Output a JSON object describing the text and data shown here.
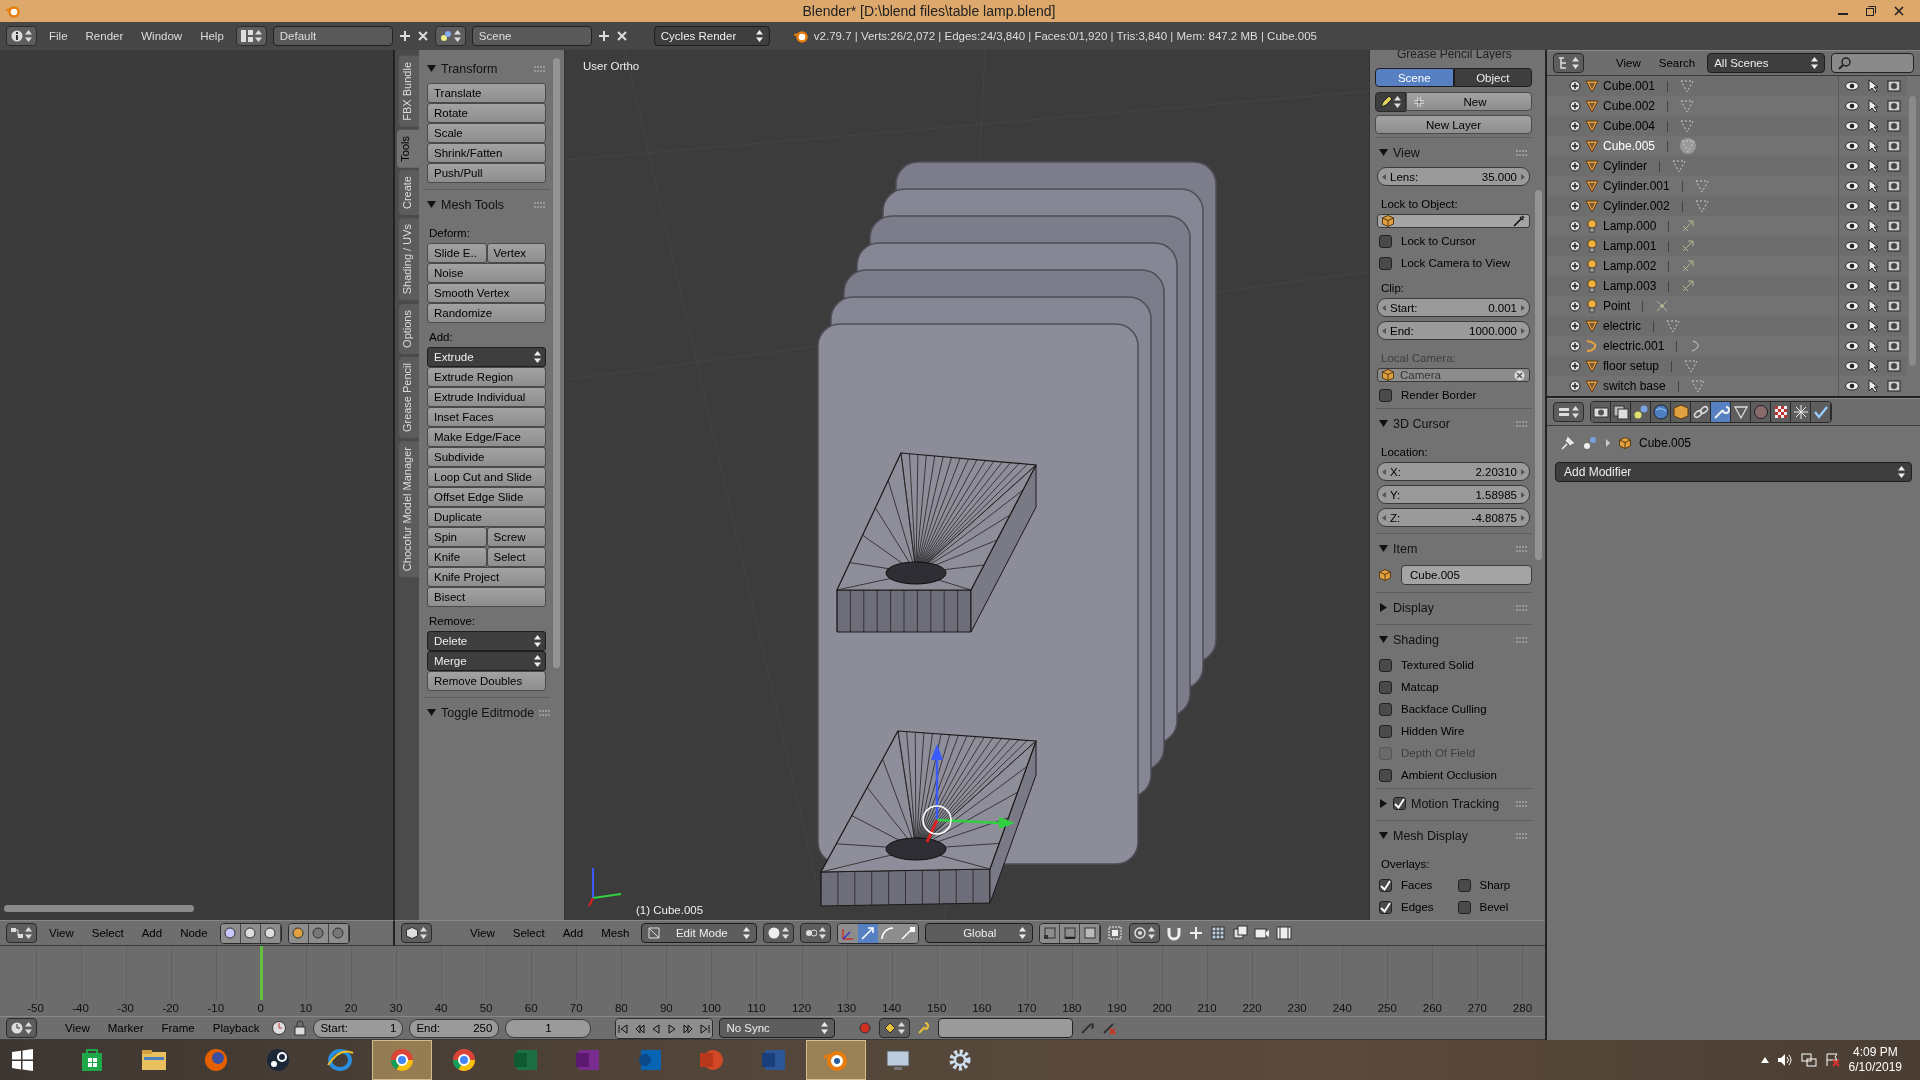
{
  "window": {
    "title": "Blender* [D:\\blend files\\table lamp.blend]"
  },
  "info_header": {
    "menus": [
      "File",
      "Render",
      "Window",
      "Help"
    ],
    "layout": "Default",
    "scene": "Scene",
    "engine": "Cycles Render",
    "stats": "v2.79.7 | Verts:26/2,072 | Edges:24/3,840 | Faces:0/1,920 | Tris:3,840 | Mem: 847.2 MB | Cube.005"
  },
  "tool_shelf": {
    "tabs": [
      {
        "label": "FBX Bundle",
        "selected": false
      },
      {
        "label": "Tools",
        "selected": true
      },
      {
        "label": "Create",
        "selected": false
      },
      {
        "label": "Shading / UVs",
        "selected": false
      },
      {
        "label": "Options",
        "selected": false
      },
      {
        "label": "Grease Pencil",
        "selected": false
      },
      {
        "label": "Chocofur Model Manager",
        "selected": false
      }
    ],
    "panels": [
      {
        "title": "Transform",
        "expanded": true,
        "rows": [
          {
            "kind": "button",
            "labels": [
              "Translate"
            ]
          },
          {
            "kind": "button",
            "labels": [
              "Rotate"
            ]
          },
          {
            "kind": "button",
            "labels": [
              "Scale"
            ]
          },
          {
            "kind": "button",
            "labels": [
              "Shrink/Fatten"
            ]
          },
          {
            "kind": "button",
            "labels": [
              "Push/Pull"
            ]
          }
        ]
      },
      {
        "title": "Mesh Tools",
        "expanded": true,
        "rows": [
          {
            "kind": "label",
            "text": "Deform:"
          },
          {
            "kind": "button",
            "labels": [
              "Slide E..",
              "Vertex"
            ]
          },
          {
            "kind": "button",
            "labels": [
              "Noise"
            ]
          },
          {
            "kind": "button",
            "labels": [
              "Smooth Vertex"
            ]
          },
          {
            "kind": "button",
            "labels": [
              "Randomize"
            ]
          },
          {
            "kind": "label",
            "text": "Add:"
          },
          {
            "kind": "dropdown",
            "text": "Extrude"
          },
          {
            "kind": "button",
            "labels": [
              "Extrude Region"
            ]
          },
          {
            "kind": "button",
            "labels": [
              "Extrude Individual"
            ]
          },
          {
            "kind": "button",
            "labels": [
              "Inset Faces"
            ]
          },
          {
            "kind": "button",
            "labels": [
              "Make Edge/Face"
            ]
          },
          {
            "kind": "button",
            "labels": [
              "Subdivide"
            ]
          },
          {
            "kind": "button",
            "labels": [
              "Loop Cut and Slide"
            ]
          },
          {
            "kind": "button",
            "labels": [
              "Offset Edge Slide"
            ]
          },
          {
            "kind": "button",
            "labels": [
              "Duplicate"
            ]
          },
          {
            "kind": "button",
            "labels": [
              "Spin",
              "Screw"
            ]
          },
          {
            "kind": "button",
            "labels": [
              "Knife",
              "Select"
            ]
          },
          {
            "kind": "button",
            "labels": [
              "Knife Project"
            ]
          },
          {
            "kind": "button",
            "labels": [
              "Bisect"
            ]
          },
          {
            "kind": "label",
            "text": "Remove:"
          },
          {
            "kind": "dropdown",
            "text": "Delete"
          },
          {
            "kind": "dropdown",
            "text": "Merge"
          },
          {
            "kind": "button",
            "labels": [
              "Remove Doubles"
            ]
          }
        ]
      },
      {
        "title": "Toggle Editmode",
        "expanded": true
      }
    ]
  },
  "viewport": {
    "view_name": "User Ortho",
    "object_label": "(1) Cube.005"
  },
  "n_panel": {
    "cut_header": "Grease Pencil Layers",
    "modes": [
      {
        "label": "Scene",
        "selected": true
      },
      {
        "label": "Object",
        "selected": false
      }
    ],
    "new_button": "New",
    "new_layer_button": "New Layer",
    "panels": [
      {
        "title": "View",
        "expanded": true,
        "rows": [
          {
            "kind": "number",
            "label": "Lens:",
            "value": "35.000"
          },
          {
            "kind": "label",
            "text": "Lock to Object:",
            "disabled": false
          },
          {
            "kind": "object_field",
            "disabled": false
          },
          {
            "kind": "checkbox",
            "text": "Lock to Cursor",
            "checked": false,
            "disabled": false
          },
          {
            "kind": "checkbox",
            "text": "Lock Camera to View",
            "checked": false,
            "disabled": false
          },
          {
            "kind": "label",
            "text": "Clip:",
            "disabled": false
          },
          {
            "kind": "number",
            "label": "Start:",
            "value": "0.001"
          },
          {
            "kind": "number",
            "label": "End:",
            "value": "1000.000"
          },
          {
            "kind": "label",
            "text": "Local Camera:",
            "disabled": true
          },
          {
            "kind": "object_field",
            "text": "Camera",
            "disabled": true
          },
          {
            "kind": "checkbox",
            "text": "Render Border",
            "checked": false,
            "disabled": false
          }
        ]
      },
      {
        "title": "3D Cursor",
        "expanded": true,
        "rows": [
          {
            "kind": "label",
            "text": "Location:",
            "disabled": false
          },
          {
            "kind": "number",
            "label": "X:",
            "value": "2.20310"
          },
          {
            "kind": "number",
            "label": "Y:",
            "value": "1.58985"
          },
          {
            "kind": "number",
            "label": "Z:",
            "value": "-4.80875"
          }
        ]
      },
      {
        "title": "Item",
        "expanded": true,
        "rows": [
          {
            "kind": "text_field",
            "text": "Cube.005"
          }
        ]
      },
      {
        "title": "Display",
        "expanded": false
      },
      {
        "title": "Shading",
        "expanded": true,
        "rows": [
          {
            "kind": "checkbox",
            "text": "Textured Solid",
            "checked": false,
            "disabled": false
          },
          {
            "kind": "checkbox",
            "text": "Matcap",
            "checked": false,
            "disabled": false
          },
          {
            "kind": "checkbox",
            "text": "Backface Culling",
            "checked": false,
            "disabled": false
          },
          {
            "kind": "checkbox",
            "text": "Hidden Wire",
            "checked": false,
            "disabled": false
          },
          {
            "kind": "checkbox",
            "text": "Depth Of Field",
            "checked": false,
            "disabled": true
          },
          {
            "kind": "checkbox",
            "text": "Ambient Occlusion",
            "checked": false,
            "disabled": false
          }
        ]
      },
      {
        "title": "Motion Tracking",
        "expanded": false,
        "checked": true
      },
      {
        "title": "Mesh Display",
        "expanded": true,
        "rows": [
          {
            "kind": "label",
            "text": "Overlays:",
            "disabled": false
          },
          {
            "kind": "checkbox_pair",
            "items": [
              {
                "text": "Faces",
                "checked": true
              },
              {
                "text": "Sharp",
                "checked": false
              }
            ]
          },
          {
            "kind": "checkbox_pair",
            "items": [
              {
                "text": "Edges",
                "checked": true
              },
              {
                "text": "Bevel",
                "checked": false
              }
            ]
          }
        ]
      }
    ]
  },
  "outliner": {
    "menus": [
      "View",
      "Search"
    ],
    "filter": "All Scenes",
    "rows": [
      {
        "name": "Cube.001",
        "kind": "mesh",
        "selected": false
      },
      {
        "name": "Cube.002",
        "kind": "mesh",
        "selected": false
      },
      {
        "name": "Cube.004",
        "kind": "mesh",
        "selected": false
      },
      {
        "name": "Cube.005",
        "kind": "mesh",
        "selected": true
      },
      {
        "name": "Cylinder",
        "kind": "mesh",
        "selected": false
      },
      {
        "name": "Cylinder.001",
        "kind": "mesh",
        "selected": false
      },
      {
        "name": "Cylinder.002",
        "kind": "mesh",
        "selected": false
      },
      {
        "name": "Lamp.000",
        "kind": "lamp",
        "selected": false
      },
      {
        "name": "Lamp.001",
        "kind": "lamp",
        "selected": false
      },
      {
        "name": "Lamp.002",
        "kind": "lamp",
        "selected": false
      },
      {
        "name": "Lamp.003",
        "kind": "lamp",
        "selected": false
      },
      {
        "name": "Point",
        "kind": "point_lamp",
        "selected": false
      },
      {
        "name": "electric",
        "kind": "mesh",
        "selected": false
      },
      {
        "name": "electric.001",
        "kind": "curve",
        "selected": false
      },
      {
        "name": "floor setup",
        "kind": "mesh",
        "selected": false
      },
      {
        "name": "switch base",
        "kind": "mesh",
        "selected": false
      }
    ]
  },
  "properties": {
    "tabs": [
      {
        "kind": "render",
        "selected": false
      },
      {
        "kind": "render_layers",
        "selected": false
      },
      {
        "kind": "scene",
        "selected": false
      },
      {
        "kind": "world",
        "selected": false
      },
      {
        "kind": "object",
        "selected": false
      },
      {
        "kind": "constraints",
        "selected": false
      },
      {
        "kind": "modifiers",
        "selected": true
      },
      {
        "kind": "data",
        "selected": false
      },
      {
        "kind": "material",
        "selected": false
      },
      {
        "kind": "texture",
        "selected": false
      },
      {
        "kind": "particles",
        "selected": false
      },
      {
        "kind": "physics",
        "selected": false
      }
    ],
    "breadcrumb": "Cube.005",
    "add_modifier": "Add Modifier"
  },
  "node_header": {
    "menus": [
      "View",
      "Select",
      "Add",
      "Node"
    ]
  },
  "view3d_header": {
    "menus": [
      "View",
      "Select",
      "Add",
      "Mesh"
    ],
    "mode": "Edit Mode",
    "orientation": "Global",
    "select_modes": [
      {
        "selected": false
      },
      {
        "selected": false
      },
      {
        "selected": false
      }
    ]
  },
  "timeline": {
    "ticks": [
      {
        "label": "-50",
        "current": false
      },
      {
        "label": "-40",
        "current": false
      },
      {
        "label": "-30",
        "current": false
      },
      {
        "label": "-20",
        "current": false
      },
      {
        "label": "-10",
        "current": false
      },
      {
        "label": "0",
        "current": true
      },
      {
        "label": "10",
        "current": false
      },
      {
        "label": "20",
        "current": false
      },
      {
        "label": "30",
        "current": false
      },
      {
        "label": "40",
        "current": false
      },
      {
        "label": "50",
        "current": false
      },
      {
        "label": "60",
        "current": false
      },
      {
        "label": "70",
        "current": false
      },
      {
        "label": "80",
        "current": false
      },
      {
        "label": "90",
        "current": false
      },
      {
        "label": "100",
        "current": false
      },
      {
        "label": "110",
        "current": false
      },
      {
        "label": "120",
        "current": false
      },
      {
        "label": "130",
        "current": false
      },
      {
        "label": "140",
        "current": false
      },
      {
        "label": "150",
        "current": false
      },
      {
        "label": "160",
        "current": false
      },
      {
        "label": "170",
        "current": false
      },
      {
        "label": "180",
        "current": false
      },
      {
        "label": "190",
        "current": false
      },
      {
        "label": "200",
        "current": false
      },
      {
        "label": "210",
        "current": false
      },
      {
        "label": "220",
        "current": false
      },
      {
        "label": "230",
        "current": false
      },
      {
        "label": "240",
        "current": false
      },
      {
        "label": "250",
        "current": false
      },
      {
        "label": "260",
        "current": false
      },
      {
        "label": "270",
        "current": false
      },
      {
        "label": "280",
        "current": false
      }
    ],
    "menus": [
      "View",
      "Marker",
      "Frame",
      "Playback"
    ],
    "start_label": "Start:",
    "start": "1",
    "end_label": "End:",
    "end": "250",
    "frame": "1",
    "sync": "No Sync"
  },
  "taskbar": {
    "apps": [
      {
        "kind": "store",
        "active": false
      },
      {
        "kind": "folder",
        "active": false
      },
      {
        "kind": "firefox",
        "active": false
      },
      {
        "kind": "steam",
        "active": false
      },
      {
        "kind": "ie",
        "active": false
      },
      {
        "kind": "chrome",
        "active": true
      },
      {
        "kind": "chrome",
        "active": false
      },
      {
        "kind": "excel",
        "active": false
      },
      {
        "kind": "onenote",
        "active": false
      },
      {
        "kind": "outlook",
        "active": false
      },
      {
        "kind": "powerpoint",
        "active": false
      },
      {
        "kind": "word",
        "active": false
      },
      {
        "kind": "blender",
        "active": true
      },
      {
        "kind": "monitor",
        "active": false
      },
      {
        "kind": "settings",
        "active": false
      }
    ],
    "time": "4:09 PM",
    "date": "6/10/2019"
  }
}
